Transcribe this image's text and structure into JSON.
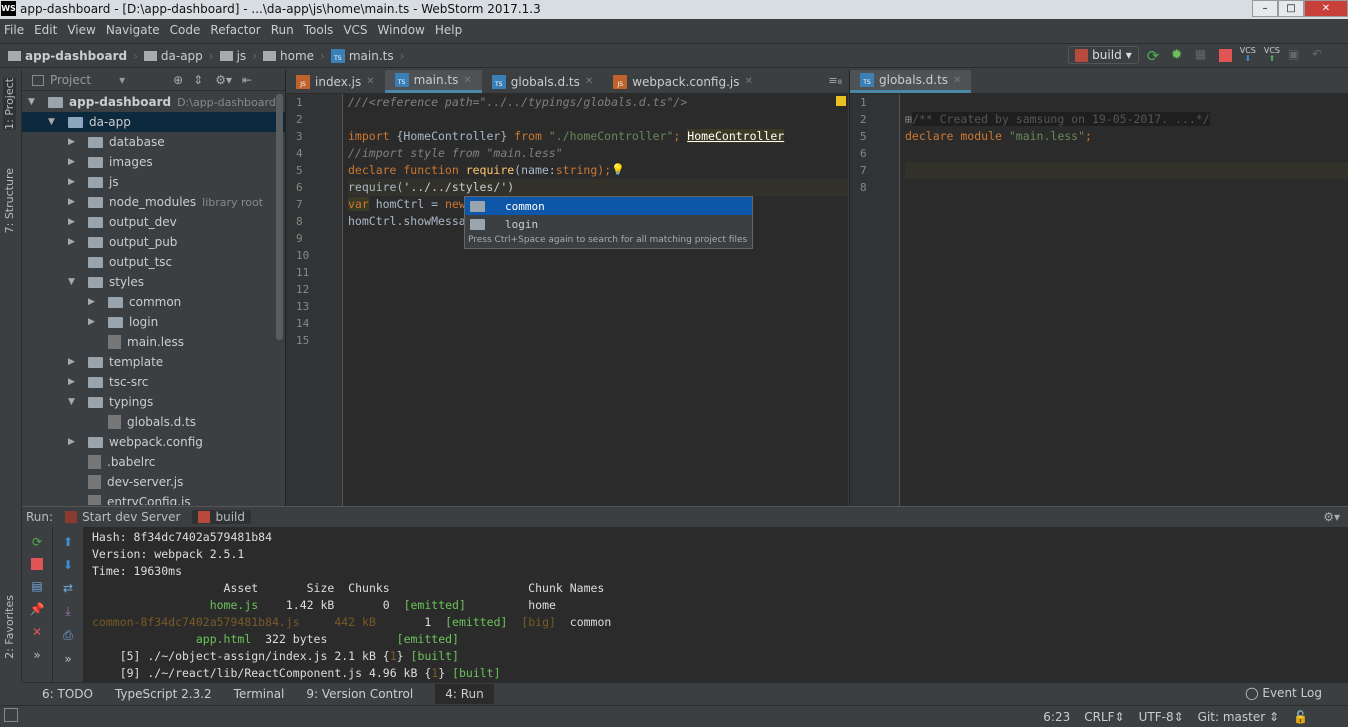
{
  "window": {
    "title": "app-dashboard - [D:\\app-dashboard] - ...\\da-app\\js\\home\\main.ts - WebStorm 2017.1.3",
    "logo": "WS"
  },
  "menu": [
    "File",
    "Edit",
    "View",
    "Navigate",
    "Code",
    "Refactor",
    "Run",
    "Tools",
    "VCS",
    "Window",
    "Help"
  ],
  "breadcrumb": [
    "app-dashboard",
    "da-app",
    "js",
    "home",
    "main.ts"
  ],
  "toolbar": {
    "run_config": "build",
    "vcs1": "VCS",
    "vcs2": "VCS"
  },
  "left_tabs": {
    "project": "1: Project",
    "structure": "7: Structure",
    "favorites": "2: Favorites"
  },
  "project": {
    "header": "Project",
    "tree": [
      {
        "label": "app-dashboard",
        "extra": "D:\\app-dashboard",
        "depth": 0,
        "type": "folder",
        "open": true
      },
      {
        "label": "da-app",
        "depth": 1,
        "type": "folder",
        "open": true,
        "selected": true
      },
      {
        "label": "database",
        "depth": 2,
        "type": "folder"
      },
      {
        "label": "images",
        "depth": 2,
        "type": "folder"
      },
      {
        "label": "js",
        "depth": 2,
        "type": "folder"
      },
      {
        "label": "node_modules",
        "extra": "library root",
        "depth": 2,
        "type": "folder"
      },
      {
        "label": "output_dev",
        "depth": 2,
        "type": "folder"
      },
      {
        "label": "output_pub",
        "depth": 2,
        "type": "folder"
      },
      {
        "label": "output_tsc",
        "depth": 2,
        "type": "folder",
        "noarrow": true
      },
      {
        "label": "styles",
        "depth": 2,
        "type": "folder",
        "open": true
      },
      {
        "label": "common",
        "depth": 3,
        "type": "folder"
      },
      {
        "label": "login",
        "depth": 3,
        "type": "folder"
      },
      {
        "label": "main.less",
        "depth": 3,
        "type": "file",
        "noarrow": true
      },
      {
        "label": "template",
        "depth": 2,
        "type": "folder"
      },
      {
        "label": "tsc-src",
        "depth": 2,
        "type": "folder"
      },
      {
        "label": "typings",
        "depth": 2,
        "type": "folder",
        "open": true
      },
      {
        "label": "globals.d.ts",
        "depth": 3,
        "type": "file",
        "noarrow": true
      },
      {
        "label": "webpack.config",
        "depth": 2,
        "type": "folder"
      },
      {
        "label": ".babelrc",
        "depth": 2,
        "type": "file",
        "noarrow": true
      },
      {
        "label": "dev-server.js",
        "depth": 2,
        "type": "file",
        "noarrow": true
      },
      {
        "label": "entryConfig.js",
        "depth": 2,
        "type": "file",
        "noarrow": true
      }
    ]
  },
  "editor": {
    "tabs": [
      {
        "label": "index.js",
        "type": "JS"
      },
      {
        "label": "main.ts",
        "type": "TS",
        "active": true
      },
      {
        "label": "globals.d.ts",
        "type": "TS"
      },
      {
        "label": "webpack.config.js",
        "type": "JS"
      }
    ],
    "line_numbers": [
      "1",
      "2",
      "3",
      "4",
      "5",
      "6",
      "7",
      "8",
      "9",
      "10",
      "11",
      "12",
      "13",
      "14",
      "15"
    ],
    "code": {
      "l1": "///<reference path=\"../../typings/globals.d.ts\"/>",
      "l3a": "import ",
      "l3b": "{HomeController} ",
      "l3c": "from ",
      "l3d": "\"./homeController\"",
      "l3e": "; ",
      "l3f": "HomeController",
      "l4": "//import style from \"main.less\"",
      "l5a": "declare function ",
      "l5b": "require",
      "l5c": "(name:",
      "l5d": "string",
      "l5e": ");",
      "l6a": "require(",
      "l6b": "'../../styles/')",
      "l7a": "var",
      "l7b": " homCtrl = ",
      "l7c": "new",
      "l8": "homCtrl.showMessa"
    },
    "completion": {
      "items": [
        "common",
        "login"
      ],
      "hint": "Press Ctrl+Space again to search for all matching project files"
    }
  },
  "editor2": {
    "tabs": [
      {
        "label": "globals.d.ts",
        "type": "TS"
      }
    ],
    "line_numbers": [
      "1",
      "2",
      "5",
      "6",
      "7",
      "8"
    ],
    "code": {
      "l2": "/** Created by samsung on 19-05-2017. ...*/",
      "l5a": "declare module ",
      "l5b": "\"main.less\"",
      "l5c": ";"
    }
  },
  "run": {
    "label": "Run:",
    "tabs": [
      "Start dev Server",
      "build"
    ],
    "console": {
      "hash": "Hash: 8f34dc7402a579481b84",
      "version": "Version: webpack 2.5.1",
      "time": "Time: 19630ms",
      "header": "                   Asset       Size  Chunks                    Chunk Names",
      "rows": [
        [
          "                 home.js",
          "    1.42 kB",
          "       0",
          "  [emitted]",
          "       ",
          "  home"
        ],
        [
          "common-8f34dc7402a579481b84.js",
          "     442 kB",
          "       1",
          "  [emitted]",
          "  [big]",
          "  common"
        ],
        [
          "               app.html",
          "  322 bytes",
          "        ",
          "  [emitted]",
          "       ",
          ""
        ]
      ],
      "m5a": "    [5] ./~/object-assign/index.js 2.1 kB {",
      "m5b": "1",
      "m5c": "} ",
      "m5d": "[built]",
      "m9a": "    [9] ./~/react/lib/ReactComponent.js 4.96 kB {",
      "m9b": "1",
      "m9c": "} ",
      "m9d": "[built]"
    }
  },
  "tool_tabs": [
    "6: TODO",
    "TypeScript 2.3.2",
    "Terminal",
    "9: Version Control",
    "4: Run"
  ],
  "event_log": "Event Log",
  "status": {
    "position": "6:23",
    "line_sep": "CRLF",
    "encoding": "UTF-8",
    "vcs": "Git: master"
  }
}
